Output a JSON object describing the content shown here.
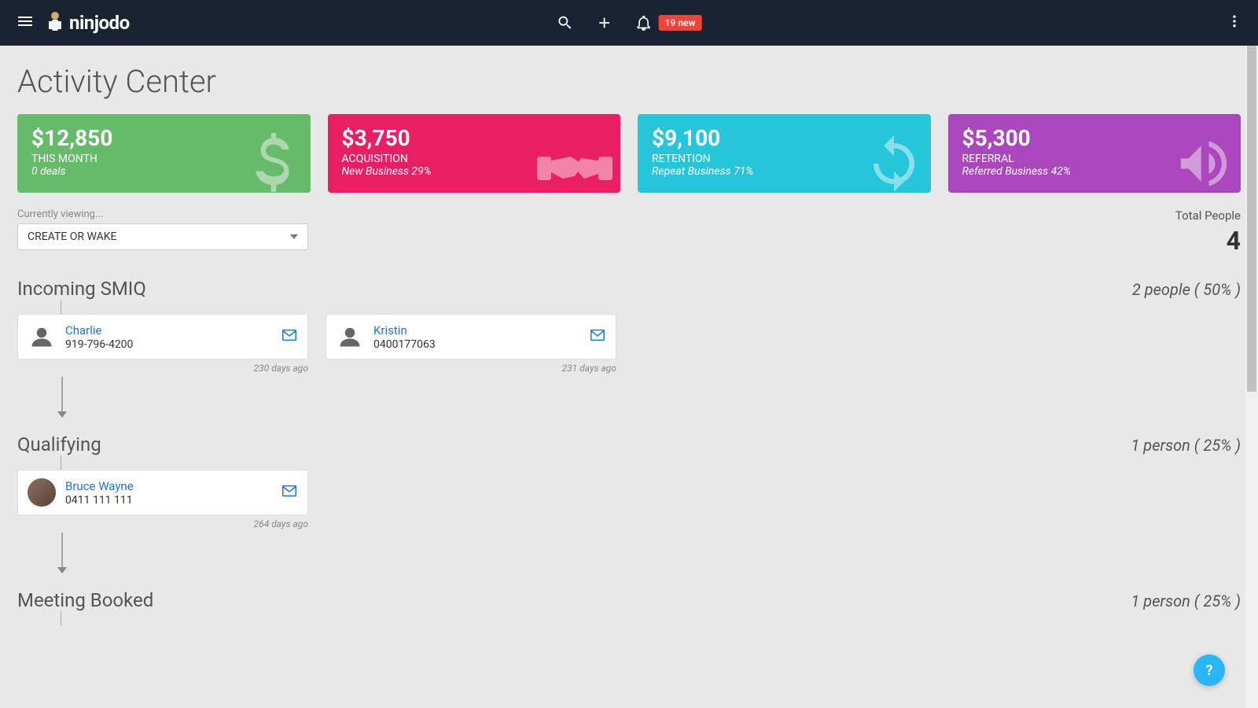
{
  "header": {
    "logo_text": "ninjodo",
    "notification_badge": "19 new"
  },
  "page": {
    "title": "Activity Center"
  },
  "cards": [
    {
      "amount": "$12,850",
      "label": "THIS MONTH",
      "sub": "0 deals",
      "color": "green",
      "icon": "dollar"
    },
    {
      "amount": "$3,750",
      "label": "ACQUISITION",
      "sub": "New Business 29%",
      "color": "pink",
      "icon": "handshake"
    },
    {
      "amount": "$9,100",
      "label": "RETENTION",
      "sub": "Repeat Business 71%",
      "color": "teal",
      "icon": "refresh"
    },
    {
      "amount": "$5,300",
      "label": "REFERRAL",
      "sub": "Referred Business 42%",
      "color": "purple",
      "icon": "megaphone"
    }
  ],
  "viewing": {
    "label": "Currently viewing...",
    "selected": "CREATE OR WAKE"
  },
  "totals": {
    "label": "Total People",
    "value": "4"
  },
  "stages": [
    {
      "title": "Incoming SMIQ",
      "count_text": "2 people ( 50% )",
      "contacts": [
        {
          "name": "Charlie",
          "phone": "919-796-4200",
          "days": "230 days ago",
          "avatar": "generic"
        },
        {
          "name": "Kristin",
          "phone": "0400177063",
          "days": "231 days ago",
          "avatar": "generic"
        }
      ]
    },
    {
      "title": "Qualifying",
      "count_text": "1 person ( 25% )",
      "contacts": [
        {
          "name": "Bruce Wayne",
          "phone": "0411 111 111",
          "days": "264 days ago",
          "avatar": "photo"
        }
      ]
    },
    {
      "title": "Meeting Booked",
      "count_text": "1 person ( 25% )",
      "contacts": []
    }
  ],
  "help": "?"
}
